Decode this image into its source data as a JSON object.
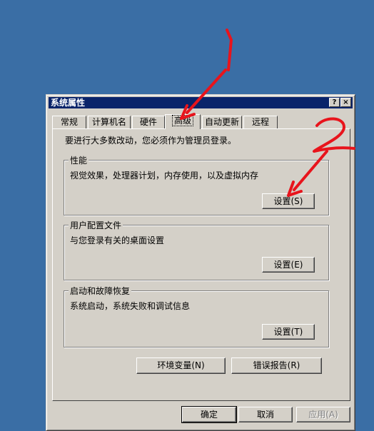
{
  "window": {
    "title": "系统属性",
    "help_label": "?",
    "close_label": "×"
  },
  "tabs": [
    {
      "label": "常规"
    },
    {
      "label": "计算机名"
    },
    {
      "label": "硬件"
    },
    {
      "label": "高级"
    },
    {
      "label": "自动更新"
    },
    {
      "label": "远程"
    }
  ],
  "active_tab": "高级",
  "intro_text": "要进行大多数改动，您必须作为管理员登录。",
  "groups": {
    "performance": {
      "title": "性能",
      "description": "视觉效果，处理器计划，内存使用，以及虚拟内存",
      "button": "设置(S)"
    },
    "user_profiles": {
      "title": "用户配置文件",
      "description": "与您登录有关的桌面设置",
      "button": "设置(E)"
    },
    "startup_recovery": {
      "title": "启动和故障恢复",
      "description": "系统启动，系统失败和调试信息",
      "button": "设置(T)"
    }
  },
  "env_button": "环境变量(N)",
  "error_button": "错误报告(R)",
  "footer": {
    "ok": "确定",
    "cancel": "取消",
    "apply": "应用(A)"
  },
  "annotations": {
    "mark1": "1",
    "mark2": "2",
    "color": "#e8141c"
  }
}
